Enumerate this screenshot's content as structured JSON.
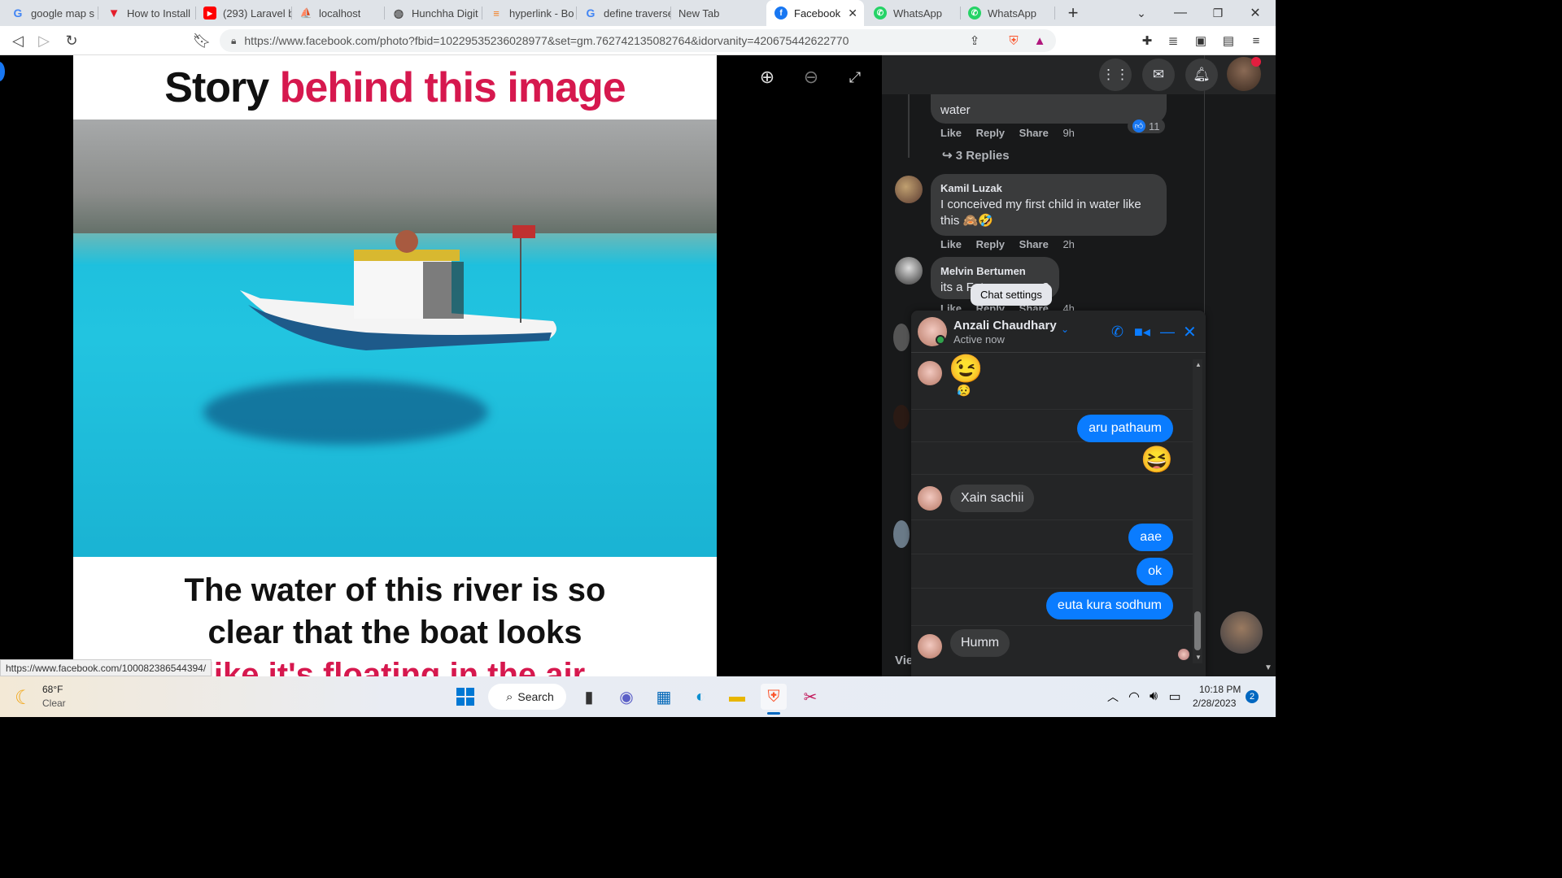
{
  "tabs": [
    {
      "label": "google map s",
      "icon": "google-icon",
      "color": "#4285f4"
    },
    {
      "label": "How to Install",
      "icon": "vercel-v-icon",
      "color": "#e41e2b"
    },
    {
      "label": "(293) Laravel b",
      "icon": "youtube-icon",
      "color": "#ff0000"
    },
    {
      "label": "localhost",
      "icon": "phpmyadmin-icon",
      "color": "#888888"
    },
    {
      "label": "Hunchha Digit",
      "icon": "globe-icon",
      "color": "#555555"
    },
    {
      "label": "hyperlink - Bo",
      "icon": "stackoverflow-icon",
      "color": "#f48024"
    },
    {
      "label": "define traverse",
      "icon": "google-icon",
      "color": "#4285f4"
    },
    {
      "label": "New Tab",
      "icon": "",
      "color": ""
    },
    {
      "label": "Facebook",
      "icon": "facebook-icon",
      "color": "#1877f2"
    },
    {
      "label": "WhatsApp",
      "icon": "whatsapp-icon",
      "color": "#25d366"
    },
    {
      "label": "WhatsApp",
      "icon": "whatsapp-icon",
      "color": "#25d366"
    }
  ],
  "address": {
    "url": "https://www.facebook.com/photo?fbid=10229535236028977&set=gm.762742135082764&idorvanity=420675442622770"
  },
  "photo": {
    "title_dark": "Story",
    "title_red": "behind this image",
    "caption_line1": "The water of this river is so",
    "caption_line2": "clear that the boat looks",
    "caption_line3": "like it's floating in the air"
  },
  "status_url": "https://www.facebook.com/100082386544394/",
  "comments": {
    "c1": {
      "text": "water",
      "like": "Like",
      "reply": "Reply",
      "share": "Share",
      "time": "9h",
      "reactions": "11",
      "replies": "3 Replies"
    },
    "c2": {
      "name": "Kamil Luzak",
      "text": "I conceived my first child in water like this 🙈🤣",
      "like": "Like",
      "reply": "Reply",
      "share": "Share",
      "time": "2h"
    },
    "c3": {
      "name": "Melvin Bertumen",
      "text": "its a Fata morgana?",
      "like": "Like",
      "reply": "Reply",
      "share": "Share",
      "time": "4h"
    },
    "partial": "Vie"
  },
  "tooltip": "Chat settings",
  "chat": {
    "name": "Anzali Chaudhary",
    "status": "Active now",
    "messages": [
      {
        "dir": "in",
        "text": "😉",
        "reaction": "😥"
      },
      {
        "dir": "out",
        "text": "aru pathaum"
      },
      {
        "dir": "out",
        "text": "😆"
      },
      {
        "dir": "in",
        "text": "Xain sachii"
      },
      {
        "dir": "out",
        "text": "aae"
      },
      {
        "dir": "out",
        "text": "ok"
      },
      {
        "dir": "out",
        "text": "euta kura sodhum"
      },
      {
        "dir": "in",
        "text": "Humm"
      }
    ]
  },
  "taskbar": {
    "weather_temp": "68°F",
    "weather_desc": "Clear",
    "search_label": "Search",
    "time": "10:18 PM",
    "date": "2/28/2023",
    "notification_count": "2"
  }
}
